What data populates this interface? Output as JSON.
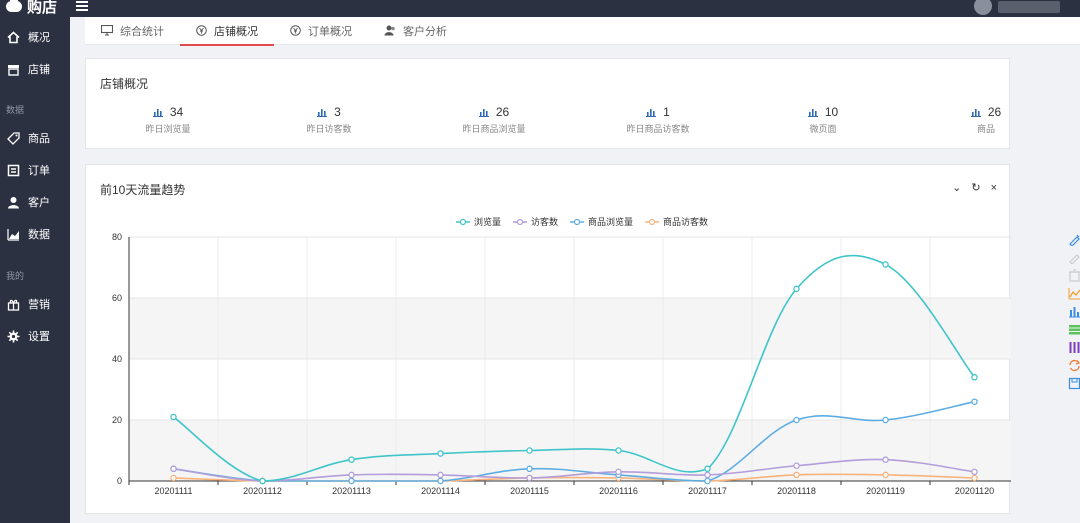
{
  "app": {
    "name": "购店"
  },
  "sidebar": {
    "items": [
      {
        "label": "概况",
        "icon": "home-icon"
      },
      {
        "label": "店铺",
        "icon": "store-icon"
      },
      {
        "label": "商品",
        "icon": "tag-icon"
      },
      {
        "label": "订单",
        "icon": "order-icon"
      },
      {
        "label": "客户",
        "icon": "user-icon"
      },
      {
        "label": "数据",
        "icon": "chart-icon"
      },
      {
        "label": "营销",
        "icon": "gift-icon"
      },
      {
        "label": "设置",
        "icon": "gear-icon"
      }
    ],
    "sections": [
      "数据",
      "我的"
    ]
  },
  "tabs": [
    {
      "label": "综合统计",
      "icon": "monitor-icon"
    },
    {
      "label": "店铺概况",
      "icon": "yen-icon",
      "active": true
    },
    {
      "label": "订单概况",
      "icon": "yen-icon"
    },
    {
      "label": "客户分析",
      "icon": "users-icon"
    }
  ],
  "overview": {
    "title": "店铺概况",
    "stats": [
      {
        "value": "34",
        "label": "昨日浏览量"
      },
      {
        "value": "3",
        "label": "昨日访客数"
      },
      {
        "value": "26",
        "label": "昨日商品浏览量"
      },
      {
        "value": "1",
        "label": "昨日商品访客数"
      },
      {
        "value": "10",
        "label": "微页面"
      },
      {
        "value": "26",
        "label": "商品"
      }
    ]
  },
  "trend": {
    "title": "前10天流量趋势",
    "tools": [
      "⌄",
      "↻",
      "×"
    ]
  },
  "colors": {
    "sidebar_bg": "#2c3142",
    "tab_active": "#e24b4b",
    "series": [
      "#3fc5c9",
      "#b39ddb",
      "#5dade2",
      "#f8b37c"
    ]
  },
  "chart_data": {
    "type": "line",
    "categories": [
      "20201111",
      "20201112",
      "20201113",
      "20201114",
      "20201115",
      "20201116",
      "20201117",
      "20201118",
      "20201119",
      "20201120"
    ],
    "series": [
      {
        "name": "浏览量",
        "values": [
          21,
          0,
          7,
          9,
          10,
          10,
          4,
          63,
          71,
          34
        ]
      },
      {
        "name": "访客数",
        "values": [
          4,
          0,
          2,
          2,
          1,
          3,
          2,
          5,
          7,
          3
        ]
      },
      {
        "name": "商品浏览量",
        "values": [
          4,
          0,
          0,
          0,
          4,
          2,
          0,
          20,
          20,
          26
        ]
      },
      {
        "name": "商品访客数",
        "values": [
          1,
          0,
          0,
          0,
          1,
          1,
          0,
          2,
          2,
          1
        ]
      }
    ],
    "ylim": [
      0,
      80
    ],
    "yticks": [
      0,
      20,
      40,
      60,
      80
    ],
    "grid": true,
    "legend": "top-center",
    "smooth": true
  }
}
